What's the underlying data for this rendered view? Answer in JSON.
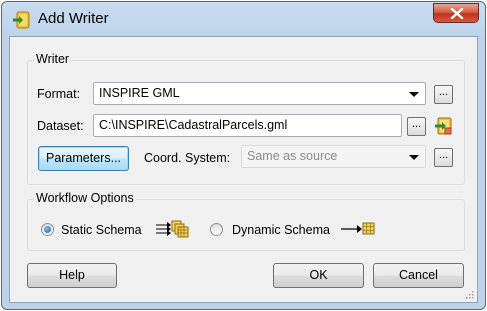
{
  "window": {
    "title": "Add Writer"
  },
  "writer_group": {
    "title": "Writer",
    "format_label": "Format:",
    "format_value": "INSPIRE GML",
    "dataset_label": "Dataset:",
    "dataset_value": "C:\\INSPIRE\\CadastralParcels.gml",
    "parameters_button": "Parameters...",
    "coord_label": "Coord. System:",
    "coord_placeholder": "Same as source",
    "ellipsis": "..."
  },
  "workflow_group": {
    "title": "Workflow Options",
    "static_schema": "Static Schema",
    "dynamic_schema": "Dynamic Schema",
    "selected": "Static Schema"
  },
  "buttons": {
    "help": "Help",
    "ok": "OK",
    "cancel": "Cancel"
  },
  "colors": {
    "accent": "#3c7fb1",
    "close": "#c0321c",
    "frame": "#bed3ea"
  },
  "icons": [
    "writer-app-icon",
    "close-icon",
    "browse-icon",
    "static-schema-icon",
    "dynamic-schema-icon",
    "resize-grip-icon"
  ]
}
